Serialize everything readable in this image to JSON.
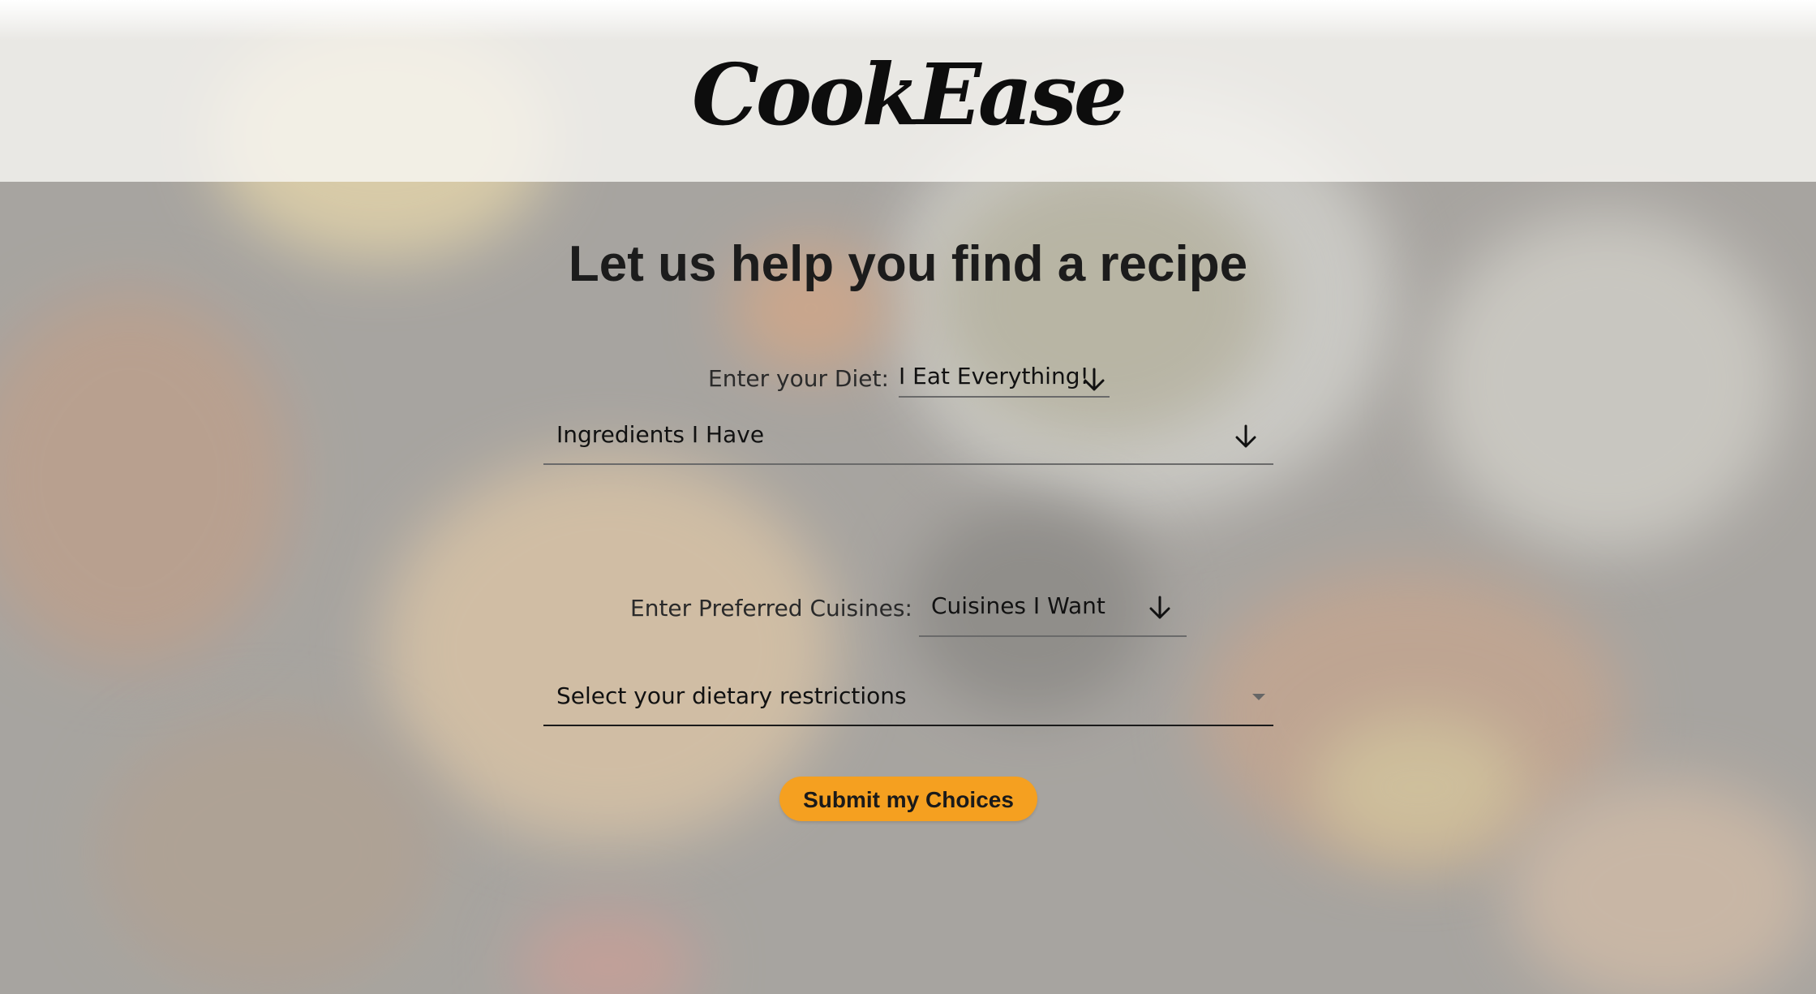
{
  "header": {
    "logo_text": "CookEase"
  },
  "main": {
    "heading": "Let us help you find a recipe",
    "diet": {
      "label": "Enter your Diet:",
      "value": "I Eat Everything!"
    },
    "ingredients": {
      "value": "Ingredients I Have"
    },
    "cuisines": {
      "label": "Enter Preferred Cuisines:",
      "value": "Cuisines I Want"
    },
    "restrictions": {
      "placeholder": "Select your dietary restrictions"
    },
    "submit_label": "Submit my Choices"
  },
  "colors": {
    "accent": "#f5a020",
    "header_bg": "#f8f6f3",
    "text": "#1a1a1a"
  },
  "icons": {
    "dropdown": "arrow-down-icon",
    "select_caret": "caret-down-icon"
  }
}
